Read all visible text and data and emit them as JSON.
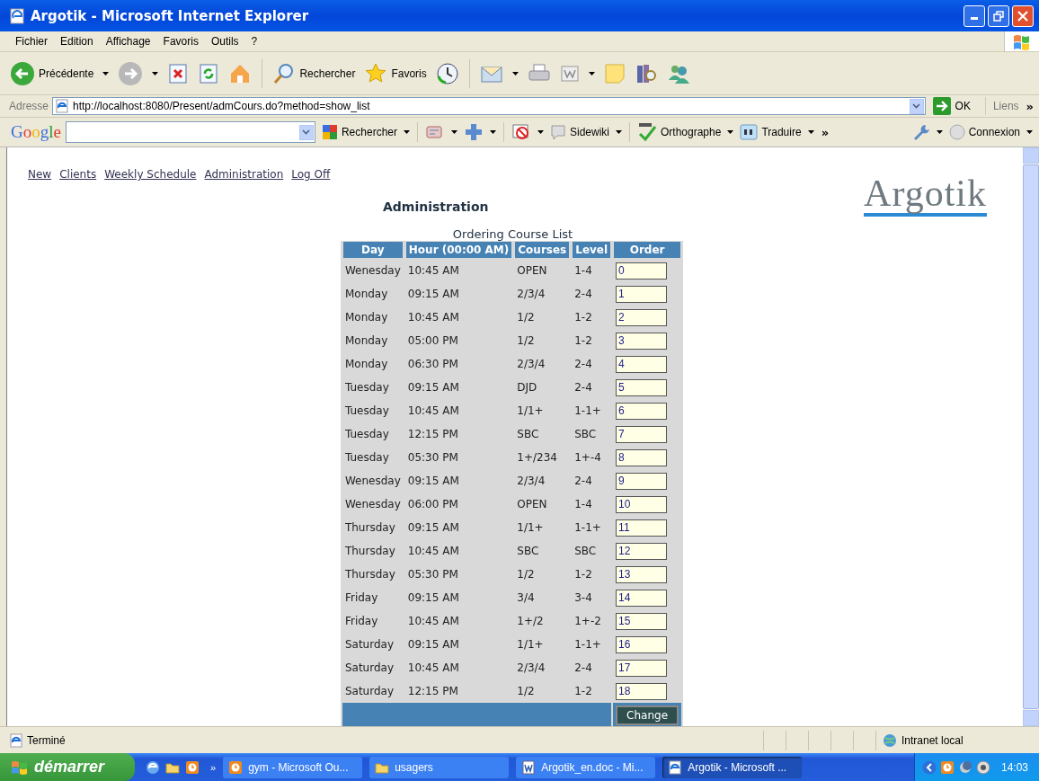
{
  "window": {
    "title": "Argotik - Microsoft Internet Explorer"
  },
  "menu": [
    "Fichier",
    "Edition",
    "Affichage",
    "Favoris",
    "Outils",
    "?"
  ],
  "toolbar": [
    {
      "kind": "back",
      "label": "Précédente",
      "dropdown": true
    },
    {
      "kind": "forward",
      "dropdown": true
    },
    {
      "kind": "stop"
    },
    {
      "kind": "refresh"
    },
    {
      "kind": "home"
    },
    {
      "kind": "search",
      "label": "Rechercher"
    },
    {
      "kind": "favorites",
      "label": "Favoris"
    },
    {
      "kind": "history"
    },
    {
      "kind": "mail",
      "dropdown": true
    },
    {
      "kind": "print"
    },
    {
      "kind": "word",
      "dropdown": true
    },
    {
      "kind": "note"
    },
    {
      "kind": "research"
    },
    {
      "kind": "messenger"
    }
  ],
  "address": {
    "label": "Adresse",
    "value": "http://localhost:8080/Present/admCours.do?method=show_list",
    "go": "OK",
    "links": "Liens",
    "more": "»"
  },
  "google_bar": {
    "logo": "Google",
    "items": [
      {
        "kind": "search",
        "label": "Rechercher"
      },
      {
        "kind": "bookmark"
      },
      {
        "kind": "plus"
      },
      {
        "kind": "block"
      },
      {
        "kind": "sidewiki",
        "label": "Sidewiki"
      },
      {
        "kind": "spell",
        "label": "Orthographe"
      },
      {
        "kind": "translate",
        "label": "Traduire"
      }
    ],
    "more": "»",
    "login": "Connexion"
  },
  "nav": [
    "New",
    "Clients",
    "Weekly Schedule",
    "Administration",
    "Log Off"
  ],
  "heading": "Administration",
  "logo": "Argotik",
  "table": {
    "caption": "Ordering Course List",
    "columns": [
      "Day",
      "Hour (00:00 AM)",
      "Courses",
      "Level",
      "Order"
    ],
    "rows": [
      {
        "day": "Wenesday",
        "hour": "10:45 AM",
        "course": "OPEN",
        "level": "1-4",
        "order": "0"
      },
      {
        "day": "Monday",
        "hour": "09:15 AM",
        "course": "2/3/4",
        "level": "2-4",
        "order": "1"
      },
      {
        "day": "Monday",
        "hour": "10:45 AM",
        "course": "1/2",
        "level": "1-2",
        "order": "2"
      },
      {
        "day": "Monday",
        "hour": "05:00 PM",
        "course": "1/2",
        "level": "1-2",
        "order": "3"
      },
      {
        "day": "Monday",
        "hour": "06:30 PM",
        "course": "2/3/4",
        "level": "2-4",
        "order": "4"
      },
      {
        "day": "Tuesday",
        "hour": "09:15 AM",
        "course": "DJD",
        "level": "2-4",
        "order": "5"
      },
      {
        "day": "Tuesday",
        "hour": "10:45 AM",
        "course": "1/1+",
        "level": "1-1+",
        "order": "6"
      },
      {
        "day": "Tuesday",
        "hour": "12:15 PM",
        "course": "SBC",
        "level": "SBC",
        "order": "7"
      },
      {
        "day": "Tuesday",
        "hour": "05:30 PM",
        "course": "1+/234",
        "level": "1+-4",
        "order": "8"
      },
      {
        "day": "Wenesday",
        "hour": "09:15 AM",
        "course": "2/3/4",
        "level": "2-4",
        "order": "9"
      },
      {
        "day": "Wenesday",
        "hour": "06:00 PM",
        "course": "OPEN",
        "level": "1-4",
        "order": "10"
      },
      {
        "day": "Thursday",
        "hour": "09:15 AM",
        "course": "1/1+",
        "level": "1-1+",
        "order": "11"
      },
      {
        "day": "Thursday",
        "hour": "10:45 AM",
        "course": "SBC",
        "level": "SBC",
        "order": "12"
      },
      {
        "day": "Thursday",
        "hour": "05:30 PM",
        "course": "1/2",
        "level": "1-2",
        "order": "13"
      },
      {
        "day": "Friday",
        "hour": "09:15 AM",
        "course": "3/4",
        "level": "3-4",
        "order": "14"
      },
      {
        "day": "Friday",
        "hour": "10:45 AM",
        "course": "1+/2",
        "level": "1+-2",
        "order": "15"
      },
      {
        "day": "Saturday",
        "hour": "09:15 AM",
        "course": "1/1+",
        "level": "1-1+",
        "order": "16"
      },
      {
        "day": "Saturday",
        "hour": "10:45 AM",
        "course": "2/3/4",
        "level": "2-4",
        "order": "17"
      },
      {
        "day": "Saturday",
        "hour": "12:15 PM",
        "course": "1/2",
        "level": "1-2",
        "order": "18"
      }
    ],
    "button": "Change"
  },
  "status_bar": {
    "text": "Terminé",
    "zone": "Intranet local"
  },
  "taskbar": {
    "start": "démarrer",
    "more": "»",
    "tasks": [
      {
        "kind": "outlook",
        "label": "gym - Microsoft Ou...",
        "selected": false
      },
      {
        "kind": "folder",
        "label": "usagers",
        "selected": false
      },
      {
        "kind": "word",
        "label": "Argotik_en.doc - Mi...",
        "selected": false
      },
      {
        "kind": "ie",
        "label": "Argotik - Microsoft ...",
        "selected": true
      }
    ],
    "clock": "14:03"
  }
}
